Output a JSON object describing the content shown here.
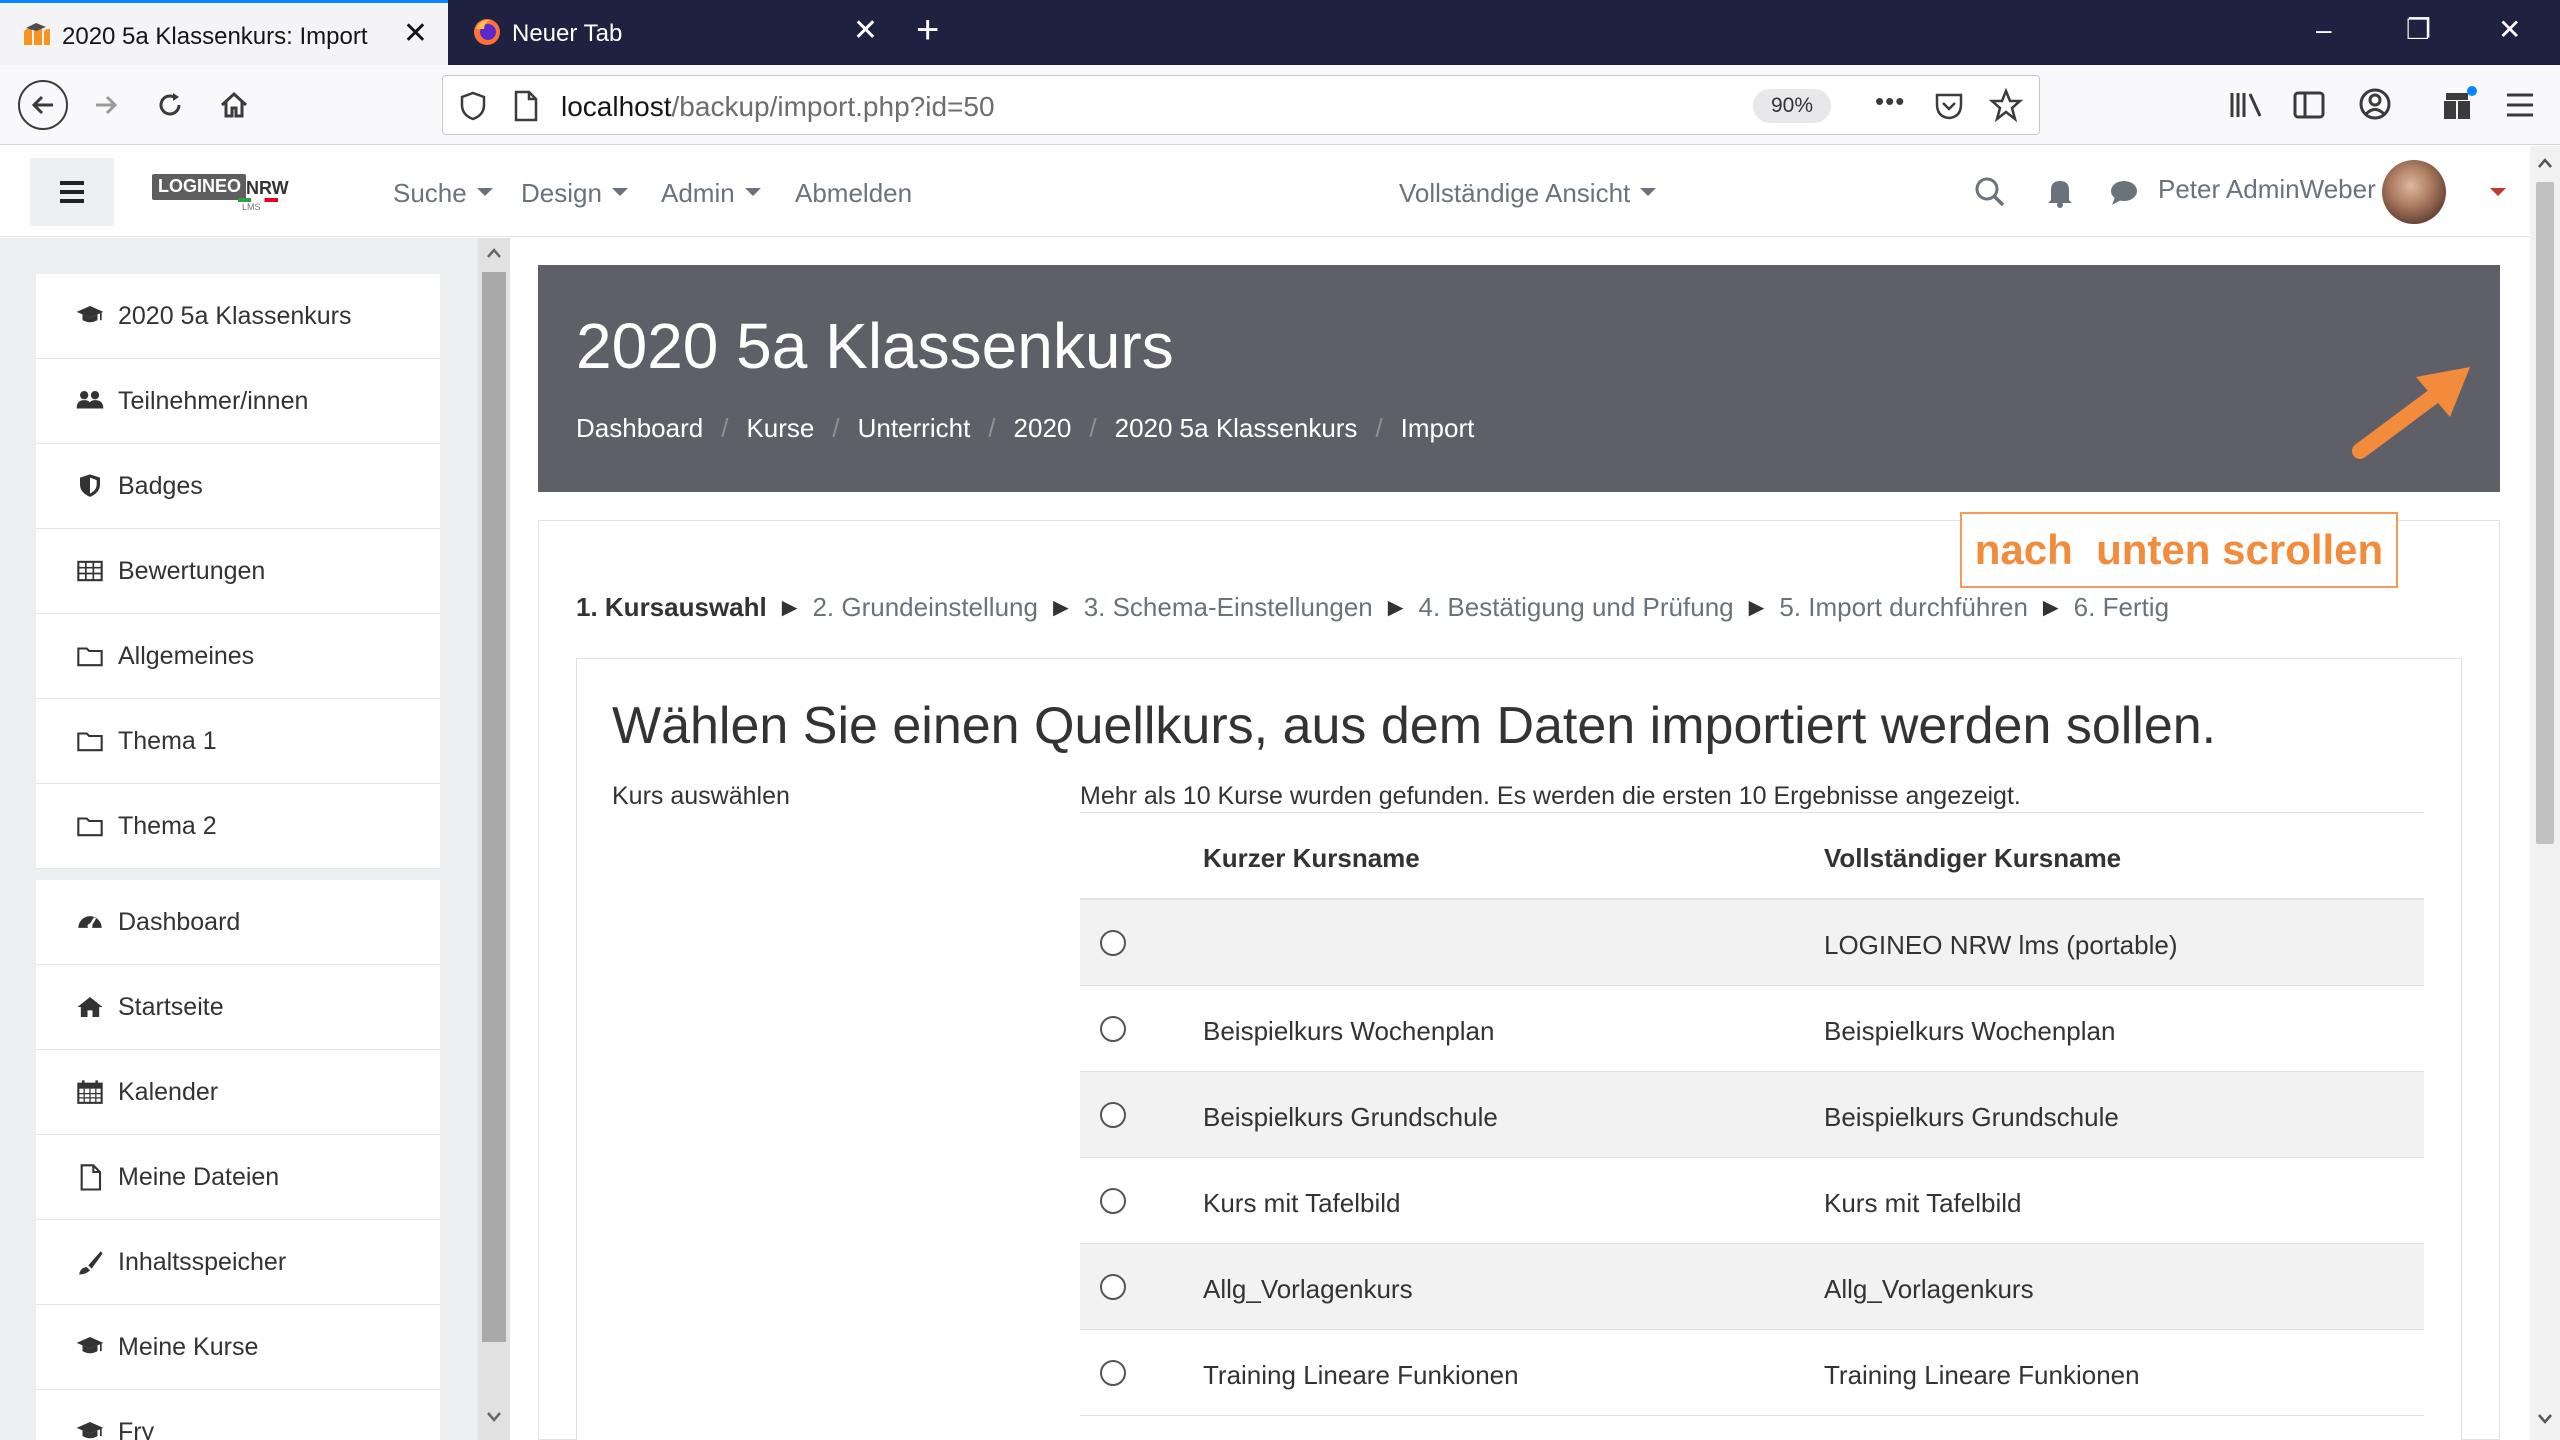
{
  "browser": {
    "tabs": [
      {
        "title": "2020 5a Klassenkurs: Import",
        "active": true,
        "close": "✕"
      },
      {
        "title": "Neuer Tab",
        "active": false,
        "close": "✕"
      }
    ],
    "new_tab": "+",
    "window_controls": {
      "minimize": "–",
      "restore": "❐",
      "close": "✕"
    },
    "url": {
      "host": "localhost",
      "path": "/backup/import.php?id=50"
    },
    "zoom": "90%",
    "more": "•••"
  },
  "header": {
    "menus": [
      {
        "label": "Suche",
        "dropdown": true
      },
      {
        "label": "Design",
        "dropdown": true
      },
      {
        "label": "Admin",
        "dropdown": true
      },
      {
        "label": "Abmelden",
        "dropdown": false
      }
    ],
    "view_mode": "Vollständige Ansicht",
    "user_name": "Peter AdminWeber",
    "logo_text_1": "LOGINEO",
    "logo_text_2": "NRW",
    "logo_sub": "LMS"
  },
  "drawer": {
    "course_items": [
      {
        "label": "2020 5a Klassenkurs",
        "icon": "graduation-cap-icon"
      },
      {
        "label": "Teilnehmer/innen",
        "icon": "users-icon"
      },
      {
        "label": "Badges",
        "icon": "shield-icon"
      },
      {
        "label": "Bewertungen",
        "icon": "table-icon"
      },
      {
        "label": "Allgemeines",
        "icon": "folder-icon"
      },
      {
        "label": "Thema 1",
        "icon": "folder-icon"
      },
      {
        "label": "Thema 2",
        "icon": "folder-icon"
      }
    ],
    "site_items": [
      {
        "label": "Dashboard",
        "icon": "dashboard-icon"
      },
      {
        "label": "Startseite",
        "icon": "home-icon"
      },
      {
        "label": "Kalender",
        "icon": "calendar-icon"
      },
      {
        "label": "Meine Dateien",
        "icon": "file-icon"
      },
      {
        "label": "Inhaltsspeicher",
        "icon": "brush-icon"
      },
      {
        "label": "Meine Kurse",
        "icon": "graduation-cap-icon"
      },
      {
        "label": "Fry",
        "icon": "graduation-cap-icon"
      }
    ]
  },
  "page": {
    "title": "2020 5a Klassenkurs",
    "breadcrumb": [
      "Dashboard",
      "Kurse",
      "Unterricht",
      "2020",
      "2020 5a Klassenkurs",
      "Import"
    ]
  },
  "annotation": "nach  unten scrollen",
  "steps": {
    "current": "1. Kursauswahl",
    "rest": [
      "2. Grundeinstellung",
      "3. Schema-Einstellungen",
      "4. Bestätigung und Prüfung",
      "5. Import durchführen",
      "6. Fertig"
    ],
    "separator": "►"
  },
  "import": {
    "heading": "Wählen Sie einen Quellkurs, aus dem Daten importiert werden sollen.",
    "select_label": "Kurs auswählen",
    "results_note": "Mehr als 10 Kurse wurden gefunden. Es werden die ersten 10 Ergebnisse angezeigt.",
    "columns": [
      "Kurzer Kursname",
      "Vollständiger Kursname"
    ],
    "rows": [
      {
        "short": "",
        "full": "LOGINEO NRW lms (portable)"
      },
      {
        "short": "Beispielkurs Wochenplan",
        "full": "Beispielkurs Wochenplan"
      },
      {
        "short": "Beispielkurs Grundschule",
        "full": "Beispielkurs Grundschule"
      },
      {
        "short": "Kurs mit Tafelbild",
        "full": "Kurs mit Tafelbild"
      },
      {
        "short": "Allg_Vorlagenkurs",
        "full": "Allg_Vorlagenkurs"
      },
      {
        "short": "Training Lineare Funkionen",
        "full": "Training Lineare Funkionen"
      }
    ]
  },
  "colors": {
    "tabbar": "#1f2141",
    "page_header": "#5f6067",
    "annotation": "#f28b3c",
    "drawer": "#eceeef"
  }
}
